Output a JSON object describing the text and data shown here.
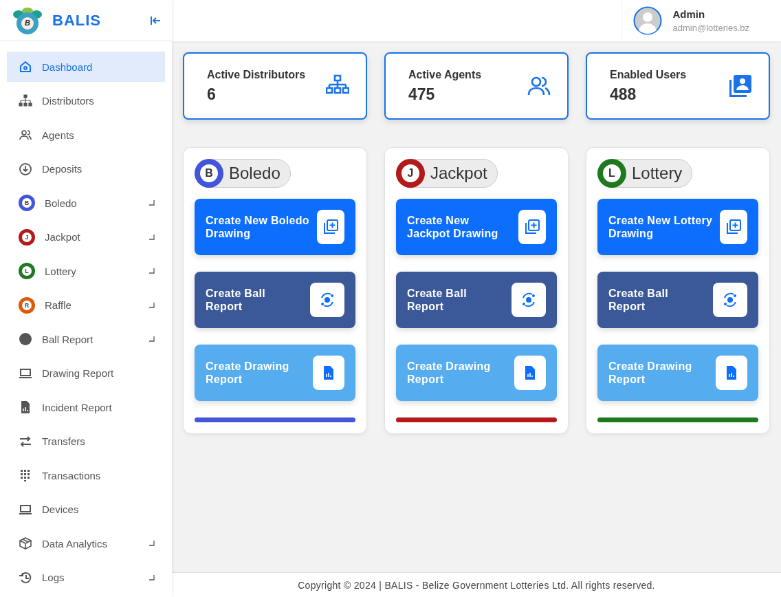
{
  "brand": {
    "name": "BALIS",
    "logo_letter": "B"
  },
  "sidebar": {
    "items": [
      {
        "label": "Dashboard",
        "selected": true,
        "expandable": false
      },
      {
        "label": "Distributors",
        "selected": false,
        "expandable": false
      },
      {
        "label": "Agents",
        "selected": false,
        "expandable": false
      },
      {
        "label": "Deposits",
        "selected": false,
        "expandable": false
      },
      {
        "label": "Boledo",
        "selected": false,
        "expandable": true,
        "badge": {
          "letter": "B",
          "color": "#4355d8"
        }
      },
      {
        "label": "Jackpot",
        "selected": false,
        "expandable": true,
        "badge": {
          "letter": "J",
          "color": "#b31b1b"
        }
      },
      {
        "label": "Lottery",
        "selected": false,
        "expandable": true,
        "badge": {
          "letter": "L",
          "color": "#1f7a1f"
        }
      },
      {
        "label": "Raffle",
        "selected": false,
        "expandable": true,
        "badge": {
          "letter": "R",
          "color": "#dc5a0a"
        }
      },
      {
        "label": "Ball Report",
        "selected": false,
        "expandable": true
      },
      {
        "label": "Drawing Report",
        "selected": false,
        "expandable": false
      },
      {
        "label": "Incident Report",
        "selected": false,
        "expandable": false
      },
      {
        "label": "Transfers",
        "selected": false,
        "expandable": false
      },
      {
        "label": "Transactions",
        "selected": false,
        "expandable": false
      },
      {
        "label": "Devices",
        "selected": false,
        "expandable": false
      },
      {
        "label": "Data Analytics",
        "selected": false,
        "expandable": true
      },
      {
        "label": "Logs",
        "selected": false,
        "expandable": true
      }
    ]
  },
  "user": {
    "name": "Admin",
    "email": "admin@lotteries.bz"
  },
  "stats": [
    {
      "label": "Active Distributors",
      "value": "6"
    },
    {
      "label": "Active Agents",
      "value": "475"
    },
    {
      "label": "Enabled Users",
      "value": "488"
    }
  ],
  "games": [
    {
      "name": "Boledo",
      "letter": "B",
      "color": "#4355d8",
      "buttons": [
        {
          "kind": "new",
          "label": "Create New Boledo Drawing"
        },
        {
          "kind": "ball",
          "label": "Create Ball Report"
        },
        {
          "kind": "report",
          "label": "Create Drawing Report"
        }
      ]
    },
    {
      "name": "Jackpot",
      "letter": "J",
      "color": "#b31b1b",
      "buttons": [
        {
          "kind": "new",
          "label": "Create New Jackpot Drawing"
        },
        {
          "kind": "ball",
          "label": "Create Ball Report"
        },
        {
          "kind": "report",
          "label": "Create Drawing Report"
        }
      ]
    },
    {
      "name": "Lottery",
      "letter": "L",
      "color": "#1f7a1f",
      "buttons": [
        {
          "kind": "new",
          "label": "Create New Lottery Drawing"
        },
        {
          "kind": "ball",
          "label": "Create Ball Report"
        },
        {
          "kind": "report",
          "label": "Create Drawing Report"
        }
      ]
    }
  ],
  "footer": "Copyright © 2024 | BALIS - Belize Government Lotteries Ltd. All rights reserved."
}
